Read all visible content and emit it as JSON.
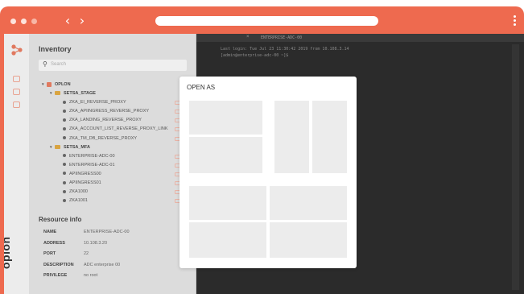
{
  "browser": {
    "back_glyph": "‹",
    "forward_glyph": "›",
    "icons": [
      "back-chevron-icon",
      "forward-chevron-icon",
      "kebab-menu-icon"
    ],
    "accent_color": "#ee6a4f"
  },
  "app": {
    "brand": "oplon"
  },
  "inventory": {
    "title": "Inventory",
    "search_placeholder": "Search",
    "tree": [
      {
        "label": "OPLON",
        "kind": "root",
        "bold": true,
        "level": 0
      },
      {
        "label": "SETSA_STAGE",
        "kind": "folder",
        "bold": true,
        "level": 1
      },
      {
        "label": "ZKA_EI_REVERSE_PROXY",
        "kind": "item",
        "level": 2,
        "tag": true
      },
      {
        "label": "ZKA_APIINGRESS_REVERSE_PROXY",
        "kind": "item",
        "level": 2,
        "tag": true
      },
      {
        "label": "ZKA_LANDING_REVERSE_PROXY",
        "kind": "item",
        "level": 2,
        "tag": true
      },
      {
        "label": "ZKA_ACCOUNT_LIST_REVERSE_PROXY_LINK",
        "kind": "item",
        "level": 2,
        "tag": true
      },
      {
        "label": "ZKA_TM_DB_REVERSE_PROXY",
        "kind": "item",
        "level": 2,
        "tag": true
      },
      {
        "label": "SETSA_MFA",
        "kind": "folder",
        "bold": true,
        "level": 1
      },
      {
        "label": "ENTERPRISE-ADC-00",
        "kind": "item",
        "level": 2,
        "tag": true
      },
      {
        "label": "ENTERPRISE-ADC-01",
        "kind": "item",
        "level": 2,
        "tag": true
      },
      {
        "label": "APIINGRESS00",
        "kind": "item",
        "level": 2,
        "tag": true
      },
      {
        "label": "APIINGRESS01",
        "kind": "item",
        "level": 2,
        "tag": true
      },
      {
        "label": "ZKA1000",
        "kind": "item",
        "level": 2,
        "tag": true
      },
      {
        "label": "ZKA1001",
        "kind": "item",
        "level": 2,
        "tag": true
      }
    ]
  },
  "resource_info": {
    "title": "Resource info",
    "rows": [
      {
        "key": "NAME",
        "value": "ENTERPRISE-ADC-00"
      },
      {
        "key": "ADDRESS",
        "value": "10.108.3.20"
      },
      {
        "key": "PORT",
        "value": "22"
      },
      {
        "key": "DESCRIPTION",
        "value": "ADC enterprise 00"
      },
      {
        "key": "PRIVILEGE",
        "value": "no root"
      }
    ]
  },
  "terminal": {
    "tab_title": "ENTERPRISE-ADC-00",
    "close_glyph": "×",
    "lines": [
      "Last login: Tue Jul 23 11:30:42 2019 from 10.108.3.14",
      "[admin@enterprise-adc-00 ~]$"
    ]
  },
  "modal": {
    "title": "OPEN AS",
    "layouts": [
      "layout-two-rows",
      "layout-two-columns",
      "layout-four-panes"
    ]
  }
}
